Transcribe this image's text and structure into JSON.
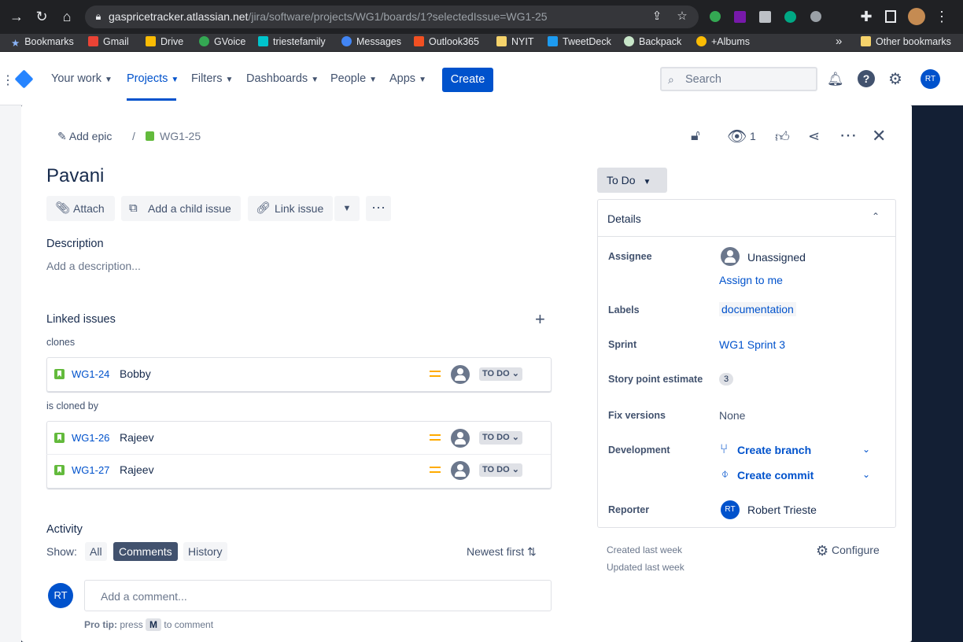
{
  "browser": {
    "url_host": "gaspricetracker.atlassian.net",
    "url_path": "/jira/software/projects/WG1/boards/1?selectedIssue=WG1-25",
    "bookmarks": [
      "Bookmarks",
      "Gmail",
      "Drive",
      "GVoice",
      "triestefamily",
      "Messages",
      "Outlook365",
      "NYIT",
      "TweetDeck",
      "Backpack",
      "+Albums"
    ],
    "other_bookmarks": "Other bookmarks",
    "more": "»"
  },
  "nav": {
    "items": [
      "Your work",
      "Projects",
      "Filters",
      "Dashboards",
      "People",
      "Apps"
    ],
    "create": "Create",
    "search_placeholder": "Search",
    "avatar": "RT"
  },
  "issue": {
    "breadcrumb_epic": "Add epic",
    "breadcrumb_sep": "/",
    "key": "WG1-25",
    "watchers": "1",
    "title": "Pavani",
    "actions": {
      "attach": "Attach",
      "child": "Add a child issue",
      "link": "Link issue"
    },
    "description_label": "Description",
    "description_placeholder": "Add a description...",
    "linked_label": "Linked issues",
    "groups": [
      {
        "relation": "clones",
        "rows": [
          {
            "key": "WG1-24",
            "summary": "Bobby",
            "status": "TO DO"
          }
        ]
      },
      {
        "relation": "is cloned by",
        "rows": [
          {
            "key": "WG1-26",
            "summary": "Rajeev",
            "status": "TO DO"
          },
          {
            "key": "WG1-27",
            "summary": "Rajeev",
            "status": "TO DO"
          }
        ]
      }
    ],
    "activity": {
      "label": "Activity",
      "show": "Show:",
      "filters": [
        "All",
        "Comments",
        "History"
      ],
      "active_filter": "Comments",
      "sort": "Newest first",
      "avatar": "RT",
      "comment_placeholder": "Add a comment...",
      "tip_bold": "Pro tip:",
      "tip_press": "press",
      "tip_key": "M",
      "tip_rest": "to comment"
    }
  },
  "details": {
    "status": "To Do",
    "header": "Details",
    "assignee_label": "Assignee",
    "assignee": "Unassigned",
    "assign_to_me": "Assign to me",
    "labels_label": "Labels",
    "label_value": "documentation",
    "sprint_label": "Sprint",
    "sprint": "WG1 Sprint 3",
    "sp_label": "Story point estimate",
    "sp": "3",
    "fix_label": "Fix versions",
    "fix": "None",
    "dev_label": "Development",
    "create_branch": "Create branch",
    "create_commit": "Create commit",
    "reporter_label": "Reporter",
    "reporter_initials": "RT",
    "reporter": "Robert Trieste",
    "created": "Created last week",
    "updated": "Updated last week",
    "configure": "Configure"
  }
}
